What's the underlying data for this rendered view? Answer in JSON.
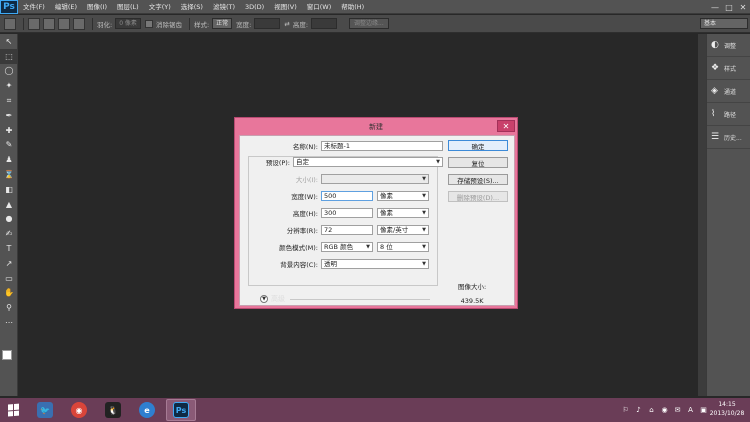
{
  "app": {
    "logo": "Ps"
  },
  "menu": [
    "文件(F)",
    "编辑(E)",
    "图像(I)",
    "图层(L)",
    "文字(Y)",
    "选择(S)",
    "滤镜(T)",
    "3D(D)",
    "视图(V)",
    "窗口(W)",
    "帮助(H)"
  ],
  "window_controls": [
    "—",
    "□",
    "✕"
  ],
  "options": {
    "feather_label": "羽化:",
    "feather_value": "0 像素",
    "antialias_label": "消除锯齿",
    "style_label": "样式:",
    "style_value": "正常",
    "width_label": "宽度:",
    "height_label": "高度:",
    "refine_button": "调整边缘...",
    "workspace": "基本"
  },
  "tools": [
    "↖",
    "⬚",
    "◯",
    "✦",
    "⌗",
    "✒",
    "✚",
    "✎",
    "♟",
    "⌛",
    "◧",
    "▲",
    "●",
    "✍",
    "T",
    "↗",
    "▭",
    "✋",
    "⚲",
    "⋯"
  ],
  "panels": [
    {
      "icon": "◐",
      "label": "调整"
    },
    {
      "icon": "❖",
      "label": "样式"
    },
    {
      "icon": "◈",
      "label": "通道"
    },
    {
      "icon": "⌇",
      "label": "路径"
    },
    {
      "icon": "☰",
      "label": "历史..."
    }
  ],
  "dialog": {
    "title": "新建",
    "close": "✕",
    "name_label": "名称(N):",
    "name_value": "未标题-1",
    "preset_label": "预设(P):",
    "preset_value": "自定",
    "size_label": "大小(I):",
    "width_label": "宽度(W):",
    "width_value": "500",
    "width_unit": "像素",
    "height_label": "高度(H):",
    "height_value": "300",
    "height_unit": "像素",
    "resolution_label": "分辨率(R):",
    "resolution_value": "72",
    "resolution_unit": "像素/英寸",
    "color_mode_label": "颜色模式(M):",
    "color_mode_value": "RGB 颜色",
    "bit_depth_value": "8 位",
    "background_label": "背景内容(C):",
    "background_value": "透明",
    "advanced_label": "高级",
    "ok_button": "确定",
    "reset_button": "复位",
    "save_preset_button": "存储预设(S)...",
    "delete_preset_button": "删除预设(D)...",
    "image_size_label": "图像大小:",
    "image_size_value": "439.5K"
  },
  "taskbar": {
    "apps": [
      {
        "name": "bird",
        "glyph": "🐦",
        "color": "#3a6fb0"
      },
      {
        "name": "chrome",
        "glyph": "◉",
        "color": "#d9453a"
      },
      {
        "name": "qq",
        "glyph": "🐧",
        "color": "#222222"
      },
      {
        "name": "ie",
        "glyph": "e",
        "color": "#2f7fd0"
      },
      {
        "name": "photoshop",
        "glyph": "Ps",
        "color": "#0f2a44"
      }
    ],
    "tray": [
      "⚐",
      "♪",
      "⌂",
      "◉",
      "✉",
      "A",
      "▣"
    ],
    "time": "14:15",
    "date": "2013/10/28"
  }
}
